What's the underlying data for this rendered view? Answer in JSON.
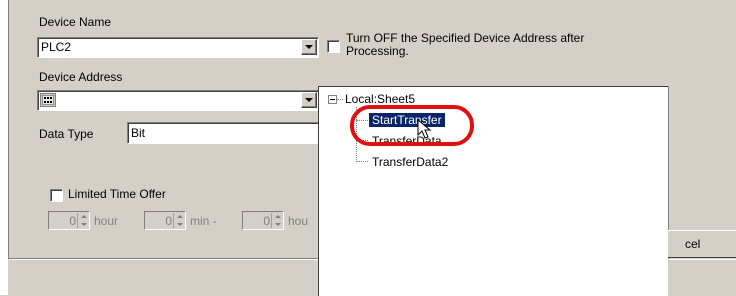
{
  "device_name": {
    "label": "Device Name",
    "value": "PLC2"
  },
  "turn_off_checkbox": {
    "label_line1": "Turn OFF the Specified Device Address after",
    "label_line2": "Processing.",
    "checked": false
  },
  "device_address": {
    "label": "Device Address",
    "value": ""
  },
  "data_type": {
    "label": "Data Type",
    "value": "Bit"
  },
  "limited_time": {
    "label": "Limited Time Offer",
    "checked": false,
    "hour_value": "0",
    "hour_label": "hour",
    "min_value": "0",
    "min_label": "min -",
    "third_value": "0",
    "third_label": "hou"
  },
  "tree": {
    "root": "Local:Sheet5",
    "items": [
      "StartTransfer",
      "TransferData",
      "TransferData2"
    ],
    "selected": "StartTransfer"
  },
  "cancel_button": {
    "label": "cel"
  },
  "highlight_color": "#e01010",
  "selection_color": "#0a246a"
}
